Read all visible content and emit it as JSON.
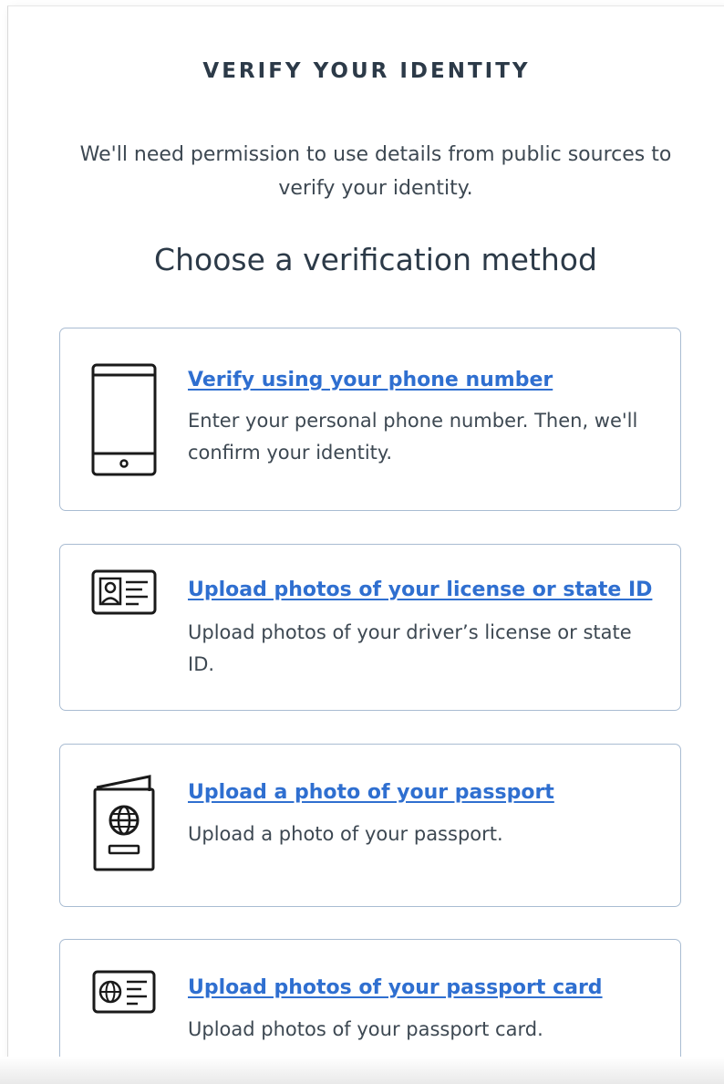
{
  "header": {
    "kicker": "VERIFY YOUR IDENTITY",
    "intro": "We'll need permission to use details from public sources to verify your identity.",
    "heading": "Choose a verification method"
  },
  "methods": [
    {
      "icon": "smartphone-icon",
      "title": "Verify using your phone number",
      "description": "Enter your personal phone number. Then, we'll confirm your identity."
    },
    {
      "icon": "id-card-icon",
      "title": "Upload photos of your license or state ID",
      "description": "Upload photos of your driver’s license or state ID."
    },
    {
      "icon": "passport-icon",
      "title": "Upload a photo of your passport",
      "description": "Upload a photo of your passport."
    },
    {
      "icon": "passport-card-icon",
      "title": "Upload photos of your passport card",
      "description": "Upload photos of your passport card."
    }
  ],
  "colors": {
    "link": "#2f6fd0",
    "card_border": "#a9bcd2",
    "heading_text": "#2c3a48",
    "body_text": "#3d4852"
  }
}
